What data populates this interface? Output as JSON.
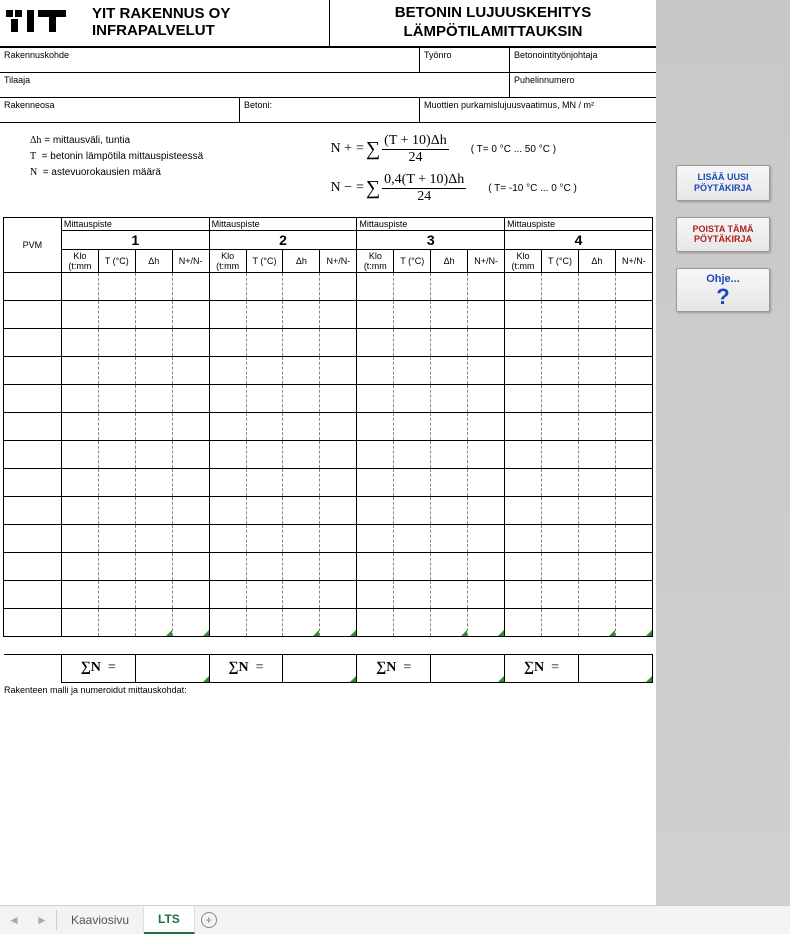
{
  "company": {
    "line1": "YIT RAKENNUS OY",
    "line2": "INFRAPALVELUT"
  },
  "title": {
    "line1": "BETONIN LUJUUSKEHITYS",
    "line2": "LÄMPÖTILAMITTAUKSIN"
  },
  "info": {
    "rakennuskohde": "Rakennuskohde",
    "tyonro": "Työnro",
    "betonointityonjohtaja": "Betonointityönjohtaja",
    "tilaaja": "Tilaaja",
    "puhelinnumero": "Puhelinnumero",
    "rakenneosa": "Rakenneosa",
    "betoni": "Betoni:",
    "muottien": "Muottien purkamislujuusvaatimus, MN / m²"
  },
  "legend": {
    "dh": "Δh",
    "dh_txt": "= mittausväli, tuntia",
    "t": "T",
    "t_txt": "= betonin lämpötila mittauspisteessä",
    "n": "N",
    "n_txt": "= astevuorokausien määrä"
  },
  "formulas": {
    "np_lhs": "N +",
    "np_rhs_num": "(T + 10)Δh",
    "np_rhs_den": "24",
    "np_note": "( T= 0 °C ... 50 °C )",
    "nm_lhs": "N −",
    "nm_rhs_num": "0,4(T + 10)Δh",
    "nm_rhs_den": "24",
    "nm_note": "( T= -10 °C ... 0 °C )",
    "eq": "=",
    "sigma": "∑"
  },
  "table": {
    "mittauspiste": "Mittauspiste",
    "pvm": "PVM",
    "groups": [
      "1",
      "2",
      "3",
      "4"
    ],
    "cols": {
      "klo": "Klo",
      "klo2": "(t:mm",
      "tc": "T (°C)",
      "dh": "Δh",
      "npm": "N+/N-"
    },
    "sum_label": "∑N",
    "eq": "="
  },
  "notes_label": "Rakenteen malli ja numeroidut mittauskohdat:",
  "buttons": {
    "add": "LISÄÄ UUSI PÖYTÄKIRJA",
    "del": "POISTA TÄMÄ PÖYTÄKIRJA",
    "help": "Ohje...",
    "help_q": "?"
  },
  "tabs": {
    "t1": "Kaaviosivu",
    "t2": "LTS"
  }
}
